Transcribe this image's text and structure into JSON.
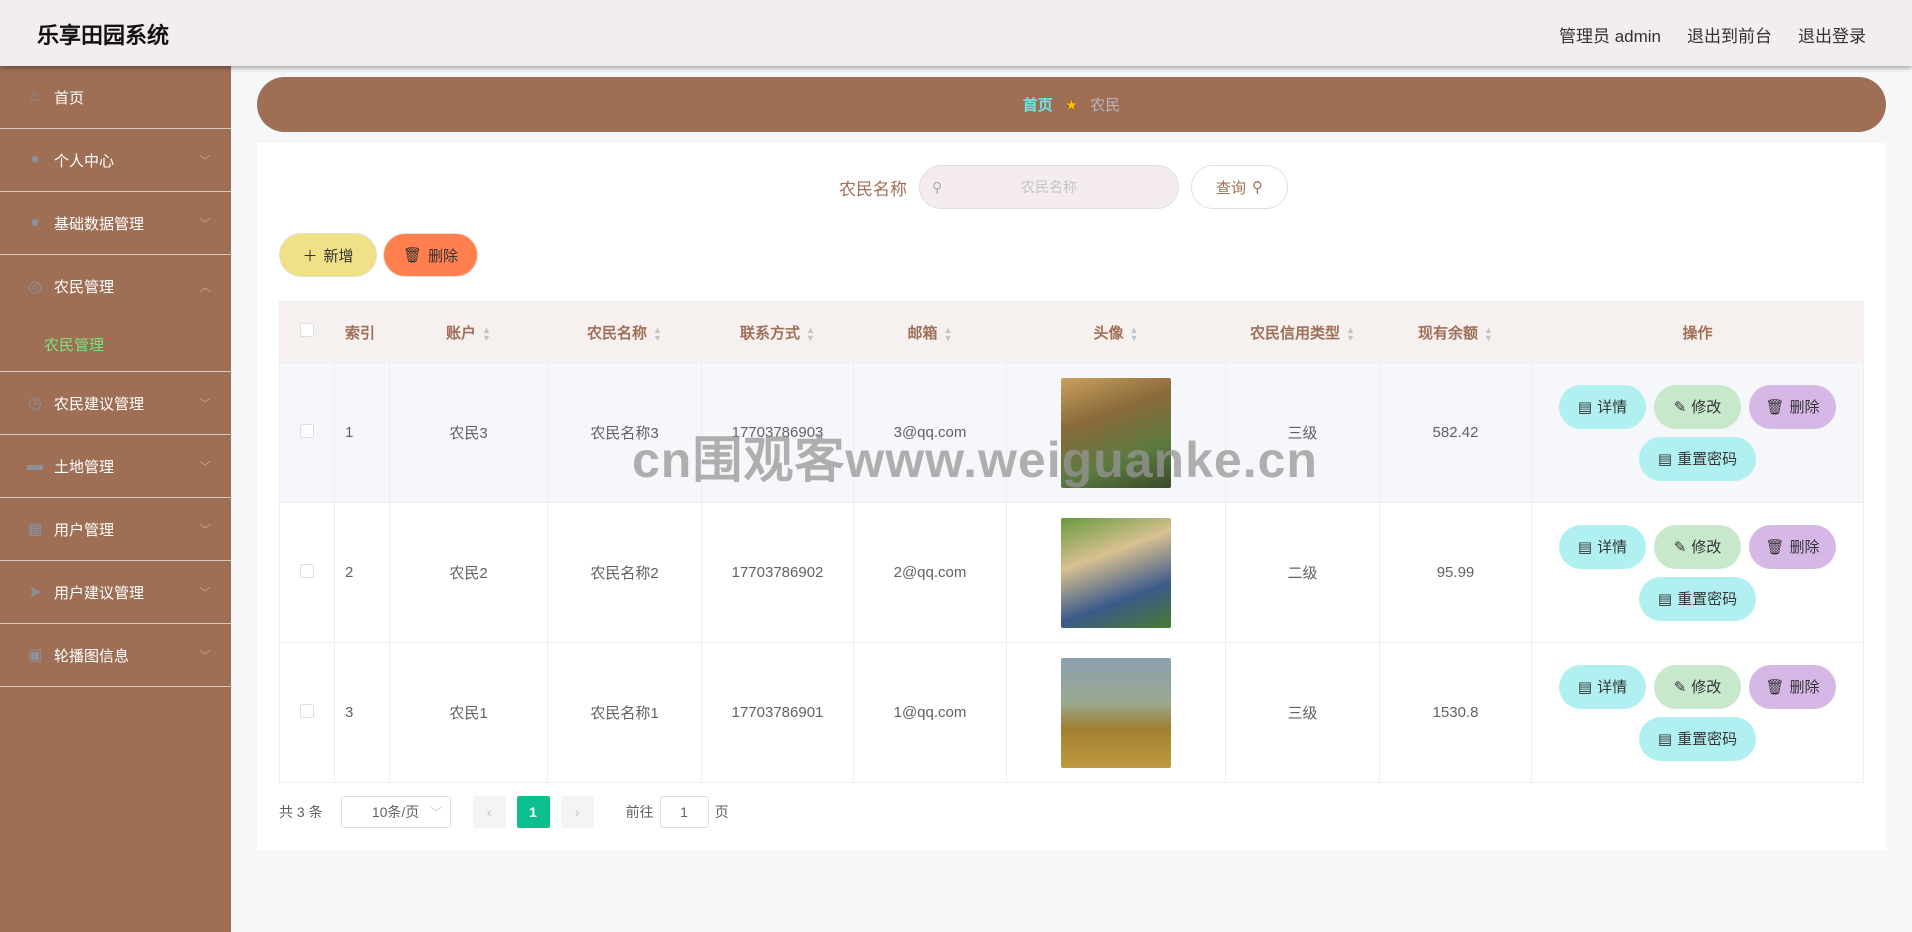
{
  "app": {
    "title": "乐享田园系统",
    "user": "管理员 admin",
    "to_front": "退出到前台",
    "logout": "退出登录"
  },
  "sidebar": {
    "items": [
      {
        "label": "首页",
        "icon": "home-icon"
      },
      {
        "label": "个人中心",
        "icon": "user-icon"
      },
      {
        "label": "基础数据管理",
        "icon": "bulb-icon"
      },
      {
        "label": "农民管理",
        "icon": "lifebuoy-icon",
        "sub": "农民管理"
      },
      {
        "label": "农民建议管理",
        "icon": "clock-icon"
      },
      {
        "label": "土地管理",
        "icon": "monitor-icon"
      },
      {
        "label": "用户管理",
        "icon": "grid-icon"
      },
      {
        "label": "用户建议管理",
        "icon": "send-icon"
      },
      {
        "label": "轮播图信息",
        "icon": "clipboard-icon"
      }
    ]
  },
  "breadcrumb": {
    "home": "首页",
    "current": "农民"
  },
  "search": {
    "label": "农民名称",
    "placeholder": "农民名称",
    "button": "查询"
  },
  "toolbar": {
    "add": "新增",
    "delete": "删除"
  },
  "table": {
    "headers": [
      "索引",
      "账户",
      "农民名称",
      "联系方式",
      "邮箱",
      "头像",
      "农民信用类型",
      "现有余额",
      "操作"
    ],
    "rows": [
      {
        "index": "1",
        "account": "农民3",
        "name": "农民名称3",
        "phone": "17703786903",
        "email": "3@qq.com",
        "credit": "三级",
        "balance": "582.42"
      },
      {
        "index": "2",
        "account": "农民2",
        "name": "农民名称2",
        "phone": "17703786902",
        "email": "2@qq.com",
        "credit": "二级",
        "balance": "95.99"
      },
      {
        "index": "3",
        "account": "农民1",
        "name": "农民名称1",
        "phone": "17703786901",
        "email": "1@qq.com",
        "credit": "三级",
        "balance": "1530.8"
      }
    ],
    "actions": {
      "detail": "详情",
      "edit": "修改",
      "delete": "删除",
      "reset": "重置密码"
    }
  },
  "pagination": {
    "total": "共 3 条",
    "page_size": "10条/页",
    "current": "1",
    "goto": "前往",
    "goto_value": "1",
    "page_suffix": "页"
  },
  "watermark": "cn围观客www.weiguanke.cn"
}
